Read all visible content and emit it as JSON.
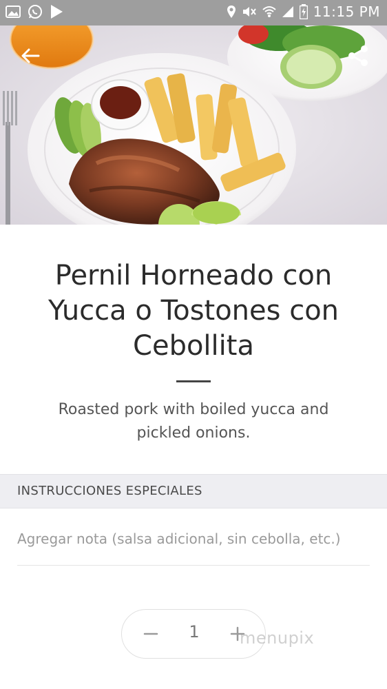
{
  "status_bar": {
    "time": "11:15 PM",
    "left_icons": [
      "image-icon",
      "whatsapp-icon",
      "play-store-icon"
    ],
    "right_icons": [
      "location-icon",
      "mute-icon",
      "wifi-icon",
      "signal-icon",
      "battery-charging-icon"
    ]
  },
  "hero": {
    "back_icon": "back-arrow-icon",
    "share_icon": "share-icon"
  },
  "item": {
    "title": "Pernil Horneado con Yucca o Tostones con Cebollita",
    "description": "Roasted pork with boiled yucca and pickled onions."
  },
  "special_instructions": {
    "header": "INSTRUCCIONES ESPECIALES",
    "placeholder": "Agregar nota (salsa adicional, sin cebolla, etc.)",
    "value": ""
  },
  "quantity": {
    "minus_label": "−",
    "value": "1",
    "plus_label": "+"
  },
  "watermark": "menupix",
  "colors": {
    "status_bar_bg": "#9e9e9e",
    "section_header_bg": "#eeeef2",
    "title_text": "#2b2b2b"
  }
}
